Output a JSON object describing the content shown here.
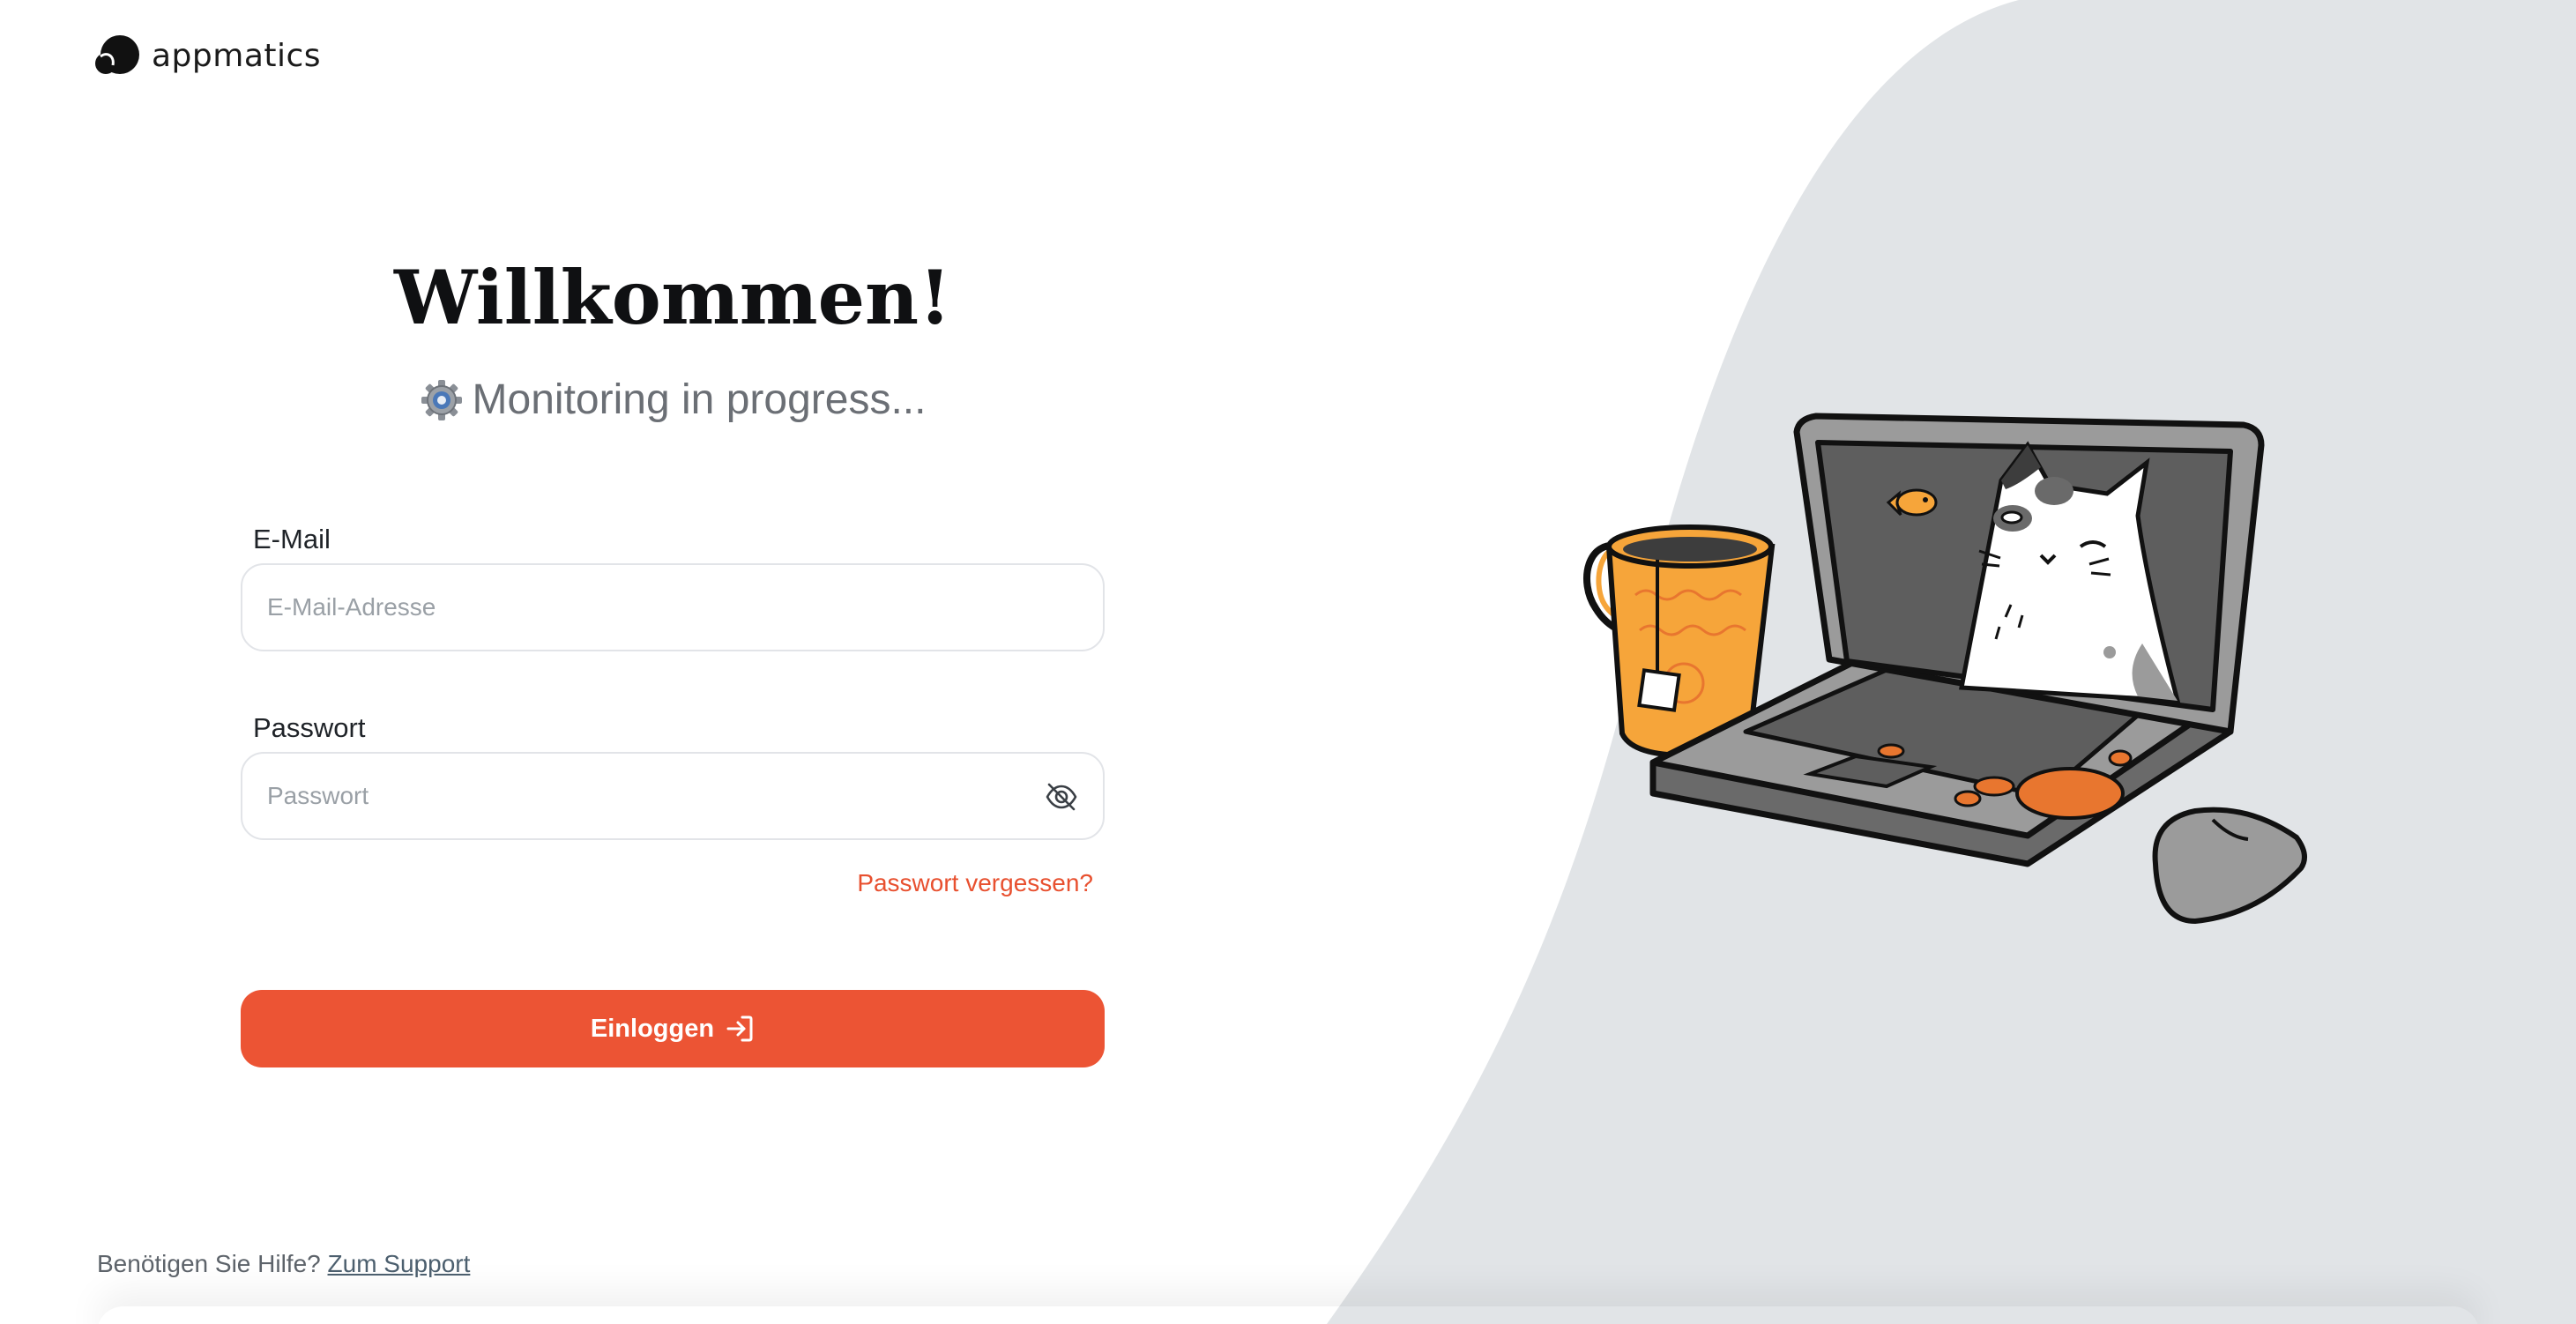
{
  "brand": {
    "name": "appmatics"
  },
  "header": {
    "title": "Willkommen!",
    "status_text": "Monitoring in progress...",
    "status_icon": "gear-icon"
  },
  "form": {
    "email": {
      "label": "E-Mail",
      "placeholder": "E-Mail-Adresse",
      "value": ""
    },
    "password": {
      "label": "Passwort",
      "placeholder": "Passwort",
      "value": "",
      "toggle_icon": "eye-off-icon"
    },
    "forgot_link": "Passwort vergessen?",
    "submit_label": "Einloggen",
    "submit_icon": "login-arrow-icon"
  },
  "footer": {
    "help_text": "Benötigen Sie Hilfe?",
    "support_link": "Zum Support"
  },
  "colors": {
    "accent": "#ec5434",
    "link": "#e8502f",
    "panel": "#e1e4e7",
    "text_muted": "#6b6f75"
  }
}
